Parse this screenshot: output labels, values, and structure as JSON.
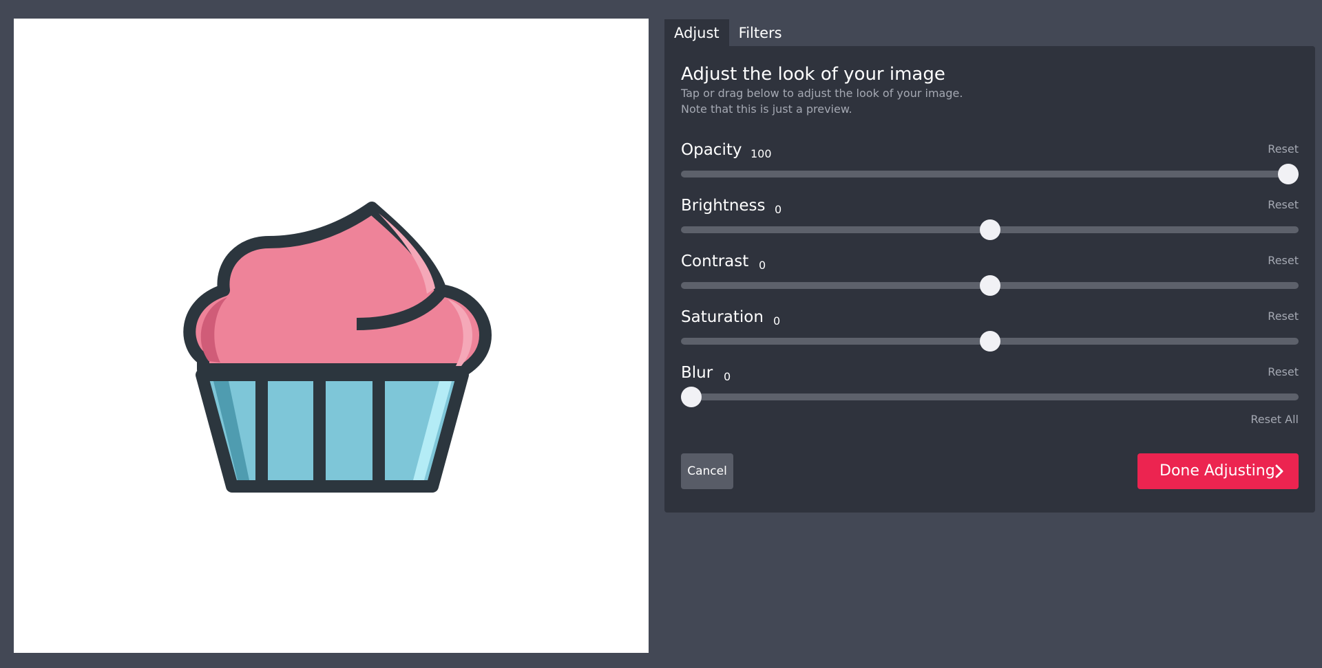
{
  "tabs": [
    {
      "label": "Adjust",
      "active": true
    },
    {
      "label": "Filters",
      "active": false
    }
  ],
  "panel": {
    "heading": "Adjust the look of your image",
    "subtitle_line1": "Tap or drag below to adjust the look of your image.",
    "subtitle_line2": "Note that this is just a preview."
  },
  "controls": [
    {
      "label": "Opacity",
      "value": "100",
      "reset": "Reset",
      "position_fraction": 1.0
    },
    {
      "label": "Brightness",
      "value": "0",
      "reset": "Reset",
      "position_fraction": 0.5
    },
    {
      "label": "Contrast",
      "value": "0",
      "reset": "Reset",
      "position_fraction": 0.5
    },
    {
      "label": "Saturation",
      "value": "0",
      "reset": "Reset",
      "position_fraction": 0.5
    },
    {
      "label": "Blur",
      "value": "0",
      "reset": "Reset",
      "position_fraction": 0.0
    }
  ],
  "reset_all": "Reset All",
  "buttons": {
    "cancel": "Cancel",
    "done": "Done Adjusting"
  },
  "icons": {
    "preview": "cupcake-image",
    "done": "chevron-right-icon"
  },
  "colors": {
    "background": "#434855",
    "panel": "#2f333d",
    "accent": "#ec2450",
    "track": "#5d616b",
    "muted_text": "#a5a9b3"
  }
}
